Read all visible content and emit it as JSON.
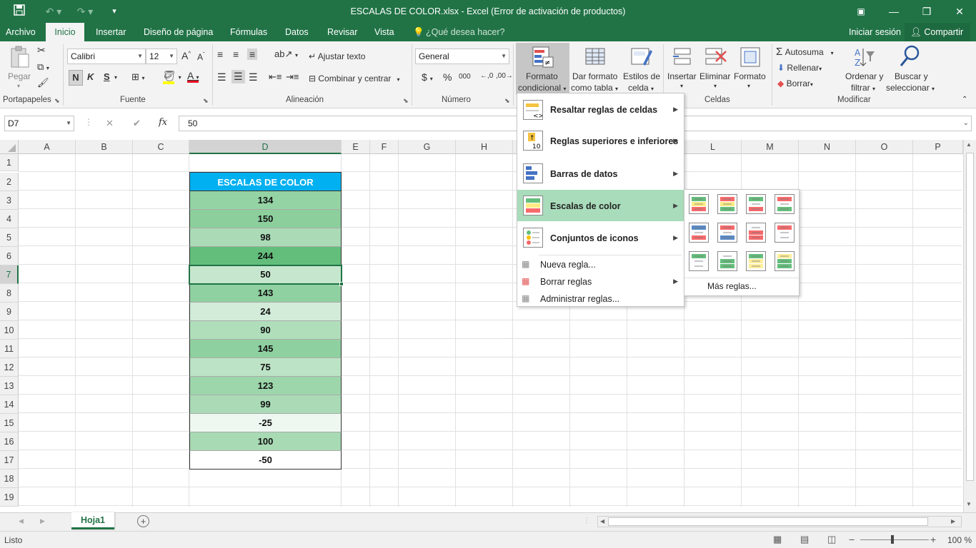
{
  "window": {
    "title": "ESCALAS DE COLOR.xlsx - Excel (Error de activación de productos)"
  },
  "tabs": [
    "Archivo",
    "Inicio",
    "Insertar",
    "Diseño de página",
    "Fórmulas",
    "Datos",
    "Revisar",
    "Vista"
  ],
  "tell_me": "¿Qué desea hacer?",
  "signin": "Iniciar sesión",
  "share": "Compartir",
  "ribbon": {
    "paste": "Pegar",
    "clipboard_group": "Portapapeles",
    "font_name": "Calibri",
    "font_size": "12",
    "bold": "N",
    "italic": "K",
    "underline": "S",
    "font_group": "Fuente",
    "wrap_text": "Ajustar texto",
    "merge_center": "Combinar y centrar",
    "alignment_group": "Alineación",
    "number_format": "General",
    "currency": "$",
    "percent": "%",
    "thousands": "000",
    "number_group": "Número",
    "cond_format_1": "Formato",
    "cond_format_2": "condicional",
    "format_table_1": "Dar formato",
    "format_table_2": "como tabla",
    "cell_styles_1": "Estilos de",
    "cell_styles_2": "celda",
    "insert": "Insertar",
    "delete": "Eliminar",
    "format": "Formato",
    "cells_group": "Celdas",
    "autosum": "Autosuma",
    "fill": "Rellenar",
    "clear": "Borrar",
    "sort_filter_1": "Ordenar y",
    "sort_filter_2": "filtrar",
    "find_select_1": "Buscar y",
    "find_select_2": "seleccionar",
    "modify_group": "Modificar"
  },
  "formula_bar": {
    "name_box": "D7",
    "fx": "fx",
    "value": "50"
  },
  "columns": [
    "A",
    "B",
    "C",
    "D",
    "E",
    "F",
    "G",
    "H",
    "I",
    "J",
    "K",
    "L",
    "M",
    "N",
    "O",
    "P"
  ],
  "rows": [
    "1",
    "2",
    "3",
    "4",
    "5",
    "6",
    "7",
    "8",
    "9",
    "10",
    "11",
    "12",
    "13",
    "14",
    "15",
    "16",
    "17",
    "18",
    "19"
  ],
  "table": {
    "header": "ESCALAS DE COLOR",
    "values": [
      "134",
      "150",
      "98",
      "244",
      "50",
      "143",
      "24",
      "90",
      "145",
      "75",
      "123",
      "99",
      "-25",
      "100",
      "-50"
    ],
    "fills": [
      "#94d3a4",
      "#8ccf9d",
      "#aadbb6",
      "#63be7b",
      "#c6e7ce",
      "#90d1a1",
      "#d3ecd9",
      "#b0deba",
      "#8fd0a0",
      "#bce3c5",
      "#9dd6ab",
      "#aadbb6",
      "#eef8f1",
      "#a8dab4",
      "#ffffff"
    ]
  },
  "cf_menu": {
    "items": [
      "Resaltar reglas de celdas",
      "Reglas superiores e inferiores",
      "Barras de datos",
      "Escalas de color",
      "Conjuntos de iconos"
    ],
    "small_items": [
      "Nueva regla...",
      "Borrar reglas",
      "Administrar reglas..."
    ],
    "more_rules": "Más reglas..."
  },
  "color_scales": [
    [
      "#63be7b",
      "#ffeb84",
      "#f8696b"
    ],
    [
      "#f8696b",
      "#ffeb84",
      "#63be7b"
    ],
    [
      "#63be7b",
      "#fcfcff",
      "#f8696b"
    ],
    [
      "#f8696b",
      "#fcfcff",
      "#63be7b"
    ],
    [
      "#5a8ac6",
      "#fcfcff",
      "#f8696b"
    ],
    [
      "#f8696b",
      "#fcfcff",
      "#5a8ac6"
    ],
    [
      "#fcfcff",
      "#f8696b",
      "#f8696b"
    ],
    [
      "#f8696b",
      "#fcfcff",
      "#fcfcff"
    ],
    [
      "#63be7b",
      "#fcfcff",
      "#fcfcff"
    ],
    [
      "#fcfcff",
      "#63be7b",
      "#63be7b"
    ],
    [
      "#63be7b",
      "#ffef9c",
      "#ffef9c"
    ],
    [
      "#ffef9c",
      "#63be7b",
      "#63be7b"
    ]
  ],
  "sheet_tab": "Hoja1",
  "status": "Listo",
  "zoom": "100 %",
  "colors": {
    "accent": "#217346",
    "header_fill": "#00b0f0"
  }
}
